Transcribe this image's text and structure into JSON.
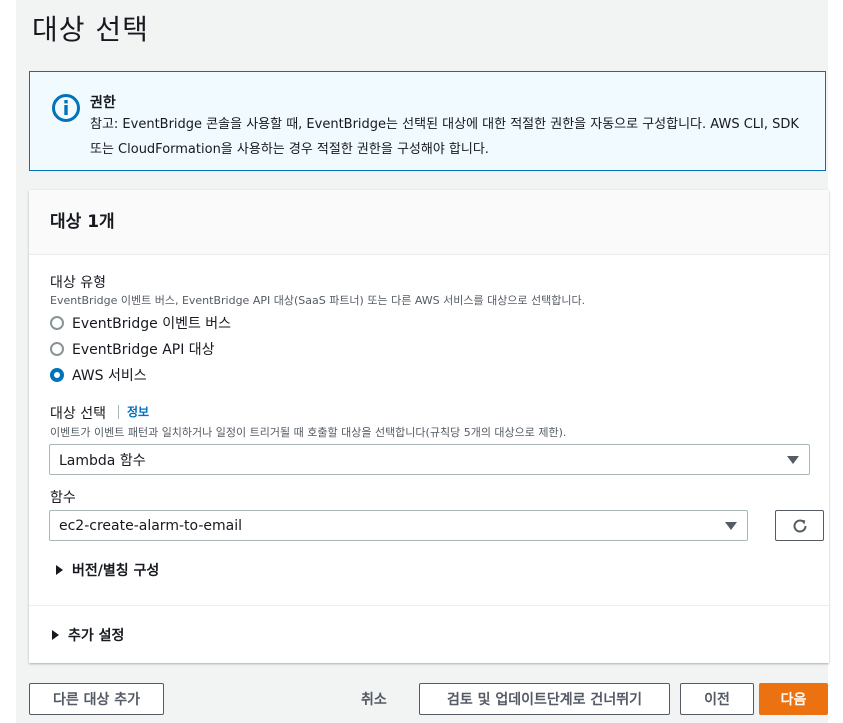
{
  "page": {
    "title": "대상 선택"
  },
  "alert": {
    "title": "권한",
    "body": "참고: EventBridge 콘솔을 사용할 때, EventBridge는 선택된 대상에 대한 적절한 권한을 자동으로 구성합니다. AWS CLI, SDK 또는 CloudFormation을 사용하는 경우 적절한 권한을 구성해야 합니다.",
    "icon": "info-icon",
    "accent": "#0073bb"
  },
  "panel": {
    "title": "대상 1개",
    "target_type": {
      "label": "대상 유형",
      "description": "EventBridge 이벤트 버스, EventBridge API 대상(SaaS 파트너) 또는 다른 AWS 서비스를 대상으로 선택합니다.",
      "options": [
        {
          "label": "EventBridge 이벤트 버스",
          "checked": false
        },
        {
          "label": "EventBridge API 대상",
          "checked": false
        },
        {
          "label": "AWS 서비스",
          "checked": true
        }
      ]
    },
    "target_select": {
      "label": "대상 선택",
      "info": "정보",
      "description": "이벤트가 이벤트 패턴과 일치하거나 일정이 트리거될 때 호출할 대상을 선택합니다(규칙당 5개의 대상으로 제한).",
      "value": "Lambda 함수"
    },
    "function": {
      "label": "함수",
      "value": "ec2-create-alarm-to-email",
      "refresh_icon": "refresh-icon"
    },
    "version_alias": "버전/별칭 구성",
    "additional_settings": "추가 설정"
  },
  "footer": {
    "add_target": "다른 대상 추가",
    "cancel": "취소",
    "skip": "검토 및 업데이트단계로 건너뛰기",
    "previous": "이전",
    "next": "다음",
    "primary_color": "#ec7211"
  }
}
